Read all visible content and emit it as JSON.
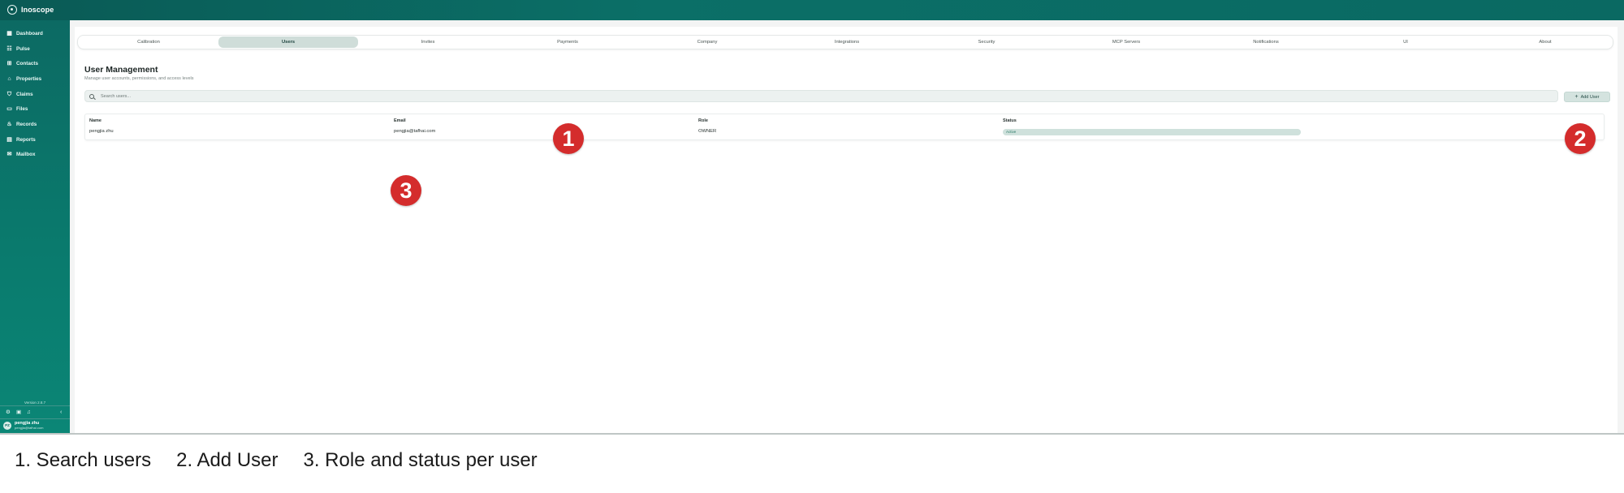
{
  "app": {
    "name": "Inoscope"
  },
  "sidebar": {
    "items": [
      {
        "label": "Dashboard",
        "icon": "dashboard-icon"
      },
      {
        "label": "Pulse",
        "icon": "pulse-icon"
      },
      {
        "label": "Contacts",
        "icon": "contacts-icon"
      },
      {
        "label": "Properties",
        "icon": "home-icon"
      },
      {
        "label": "Claims",
        "icon": "shield-icon"
      },
      {
        "label": "Files",
        "icon": "folder-icon"
      },
      {
        "label": "Records",
        "icon": "flame-icon"
      },
      {
        "label": "Reports",
        "icon": "report-icon"
      },
      {
        "label": "Mailbox",
        "icon": "mail-icon"
      }
    ],
    "version": "Version 2.8.7",
    "footer_icons": [
      "settings-icon",
      "book-icon",
      "bell-icon"
    ],
    "user": {
      "initials": "PZ",
      "name": "pengjia zhu",
      "email": "pengjia@tafhai.com"
    }
  },
  "tabs": [
    {
      "label": "Calibration"
    },
    {
      "label": "Users",
      "active": true
    },
    {
      "label": "Invites"
    },
    {
      "label": "Payments"
    },
    {
      "label": "Company"
    },
    {
      "label": "Integrations"
    },
    {
      "label": "Security"
    },
    {
      "label": "MCP Servers"
    },
    {
      "label": "Notifications"
    },
    {
      "label": "UI"
    },
    {
      "label": "About"
    }
  ],
  "page": {
    "title": "User Management",
    "subtitle": "Manage user accounts, permissions, and access levels",
    "search_placeholder": "Search users...",
    "add_button_label": "Add User"
  },
  "table": {
    "columns": [
      "Name",
      "Email",
      "Role",
      "Status"
    ],
    "rows": [
      {
        "name": "pengjia zhu",
        "email": "pengjia@tafhai.com",
        "role": "OWNER",
        "status": "Active"
      }
    ]
  },
  "annotations": {
    "badges": [
      "1",
      "2",
      "3"
    ],
    "caption": [
      "1. Search users",
      "2. Add User",
      "3. Role and status per user"
    ],
    "badge_color": "#d42c2c"
  },
  "colors": {
    "brand": "#0a6a62",
    "active_tab": "#cfddd9",
    "status_active": "#cfe1dc"
  }
}
